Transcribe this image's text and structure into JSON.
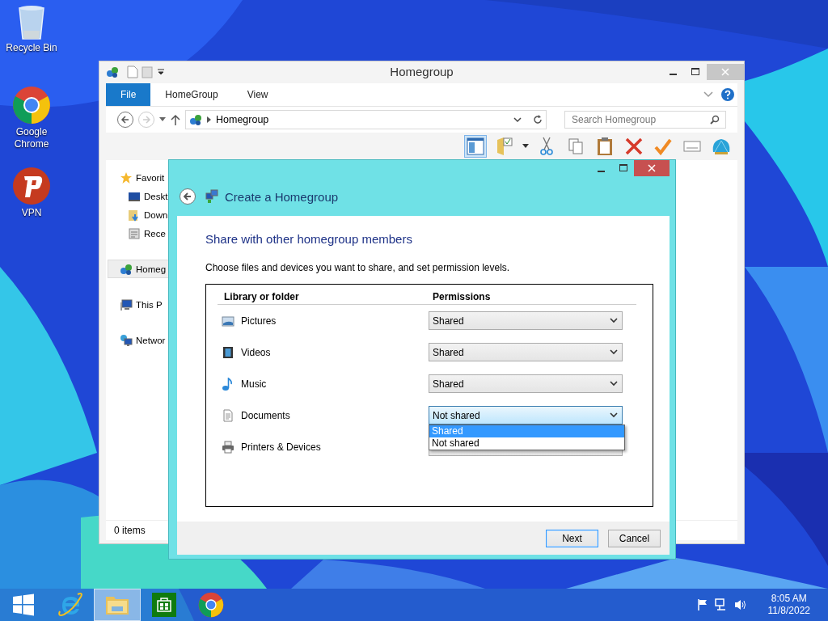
{
  "desktop_icons": [
    {
      "label": "Recycle Bin",
      "kind": "bin"
    },
    {
      "label": "Google Chrome",
      "kind": "chrome"
    },
    {
      "label": "VPN",
      "kind": "vpn"
    }
  ],
  "explorer": {
    "title": "Homegroup",
    "ribbon_tabs": [
      {
        "label": "File",
        "selected": true
      },
      {
        "label": "HomeGroup",
        "selected": false
      },
      {
        "label": "View",
        "selected": false
      }
    ],
    "address": "Homegroup",
    "search": {
      "placeholder": "Search Homegroup"
    },
    "sidebar": [
      {
        "label": "Favorit",
        "kind": "star",
        "selected": false,
        "children": [
          {
            "label": "Deskt",
            "kind": "desktop",
            "selected": false
          },
          {
            "label": "Down",
            "kind": "downloads",
            "selected": false
          },
          {
            "label": "Rece",
            "kind": "recent",
            "selected": false
          }
        ]
      },
      {
        "label": "Homeg",
        "kind": "homegroup",
        "selected": true
      },
      {
        "label": "This P",
        "kind": "pc",
        "selected": false
      },
      {
        "label": "Networ",
        "kind": "network",
        "selected": false
      }
    ],
    "status": "0 items"
  },
  "dialog": {
    "title": "Create a Homegroup",
    "heading": "Share with other homegroup members",
    "description": "Choose files and devices you want to share, and set permission levels.",
    "columns": [
      "Library or folder",
      "Permissions"
    ],
    "rows": [
      {
        "name": "Pictures",
        "kind": "pictures",
        "permission": "Shared",
        "focused": false
      },
      {
        "name": "Videos",
        "kind": "videos",
        "permission": "Shared",
        "focused": false
      },
      {
        "name": "Music",
        "kind": "music",
        "permission": "Shared",
        "focused": false
      },
      {
        "name": "Documents",
        "kind": "documents",
        "permission": "Not shared",
        "focused": true,
        "options": [
          {
            "label": "Shared",
            "selected": true
          },
          {
            "label": "Not shared",
            "selected": false
          }
        ]
      },
      {
        "name": "Printers & Devices",
        "kind": "printers",
        "focused": false
      }
    ],
    "buttons": [
      {
        "label": "Next",
        "default": true
      },
      {
        "label": "Cancel",
        "default": false
      }
    ]
  },
  "taskbar": {
    "apps": [
      {
        "kind": "ie",
        "active": false
      },
      {
        "kind": "explorer",
        "active": true
      },
      {
        "kind": "store",
        "active": false
      },
      {
        "kind": "chrome",
        "active": false
      }
    ],
    "time": "8:05 AM",
    "date": "11/8/2022"
  }
}
